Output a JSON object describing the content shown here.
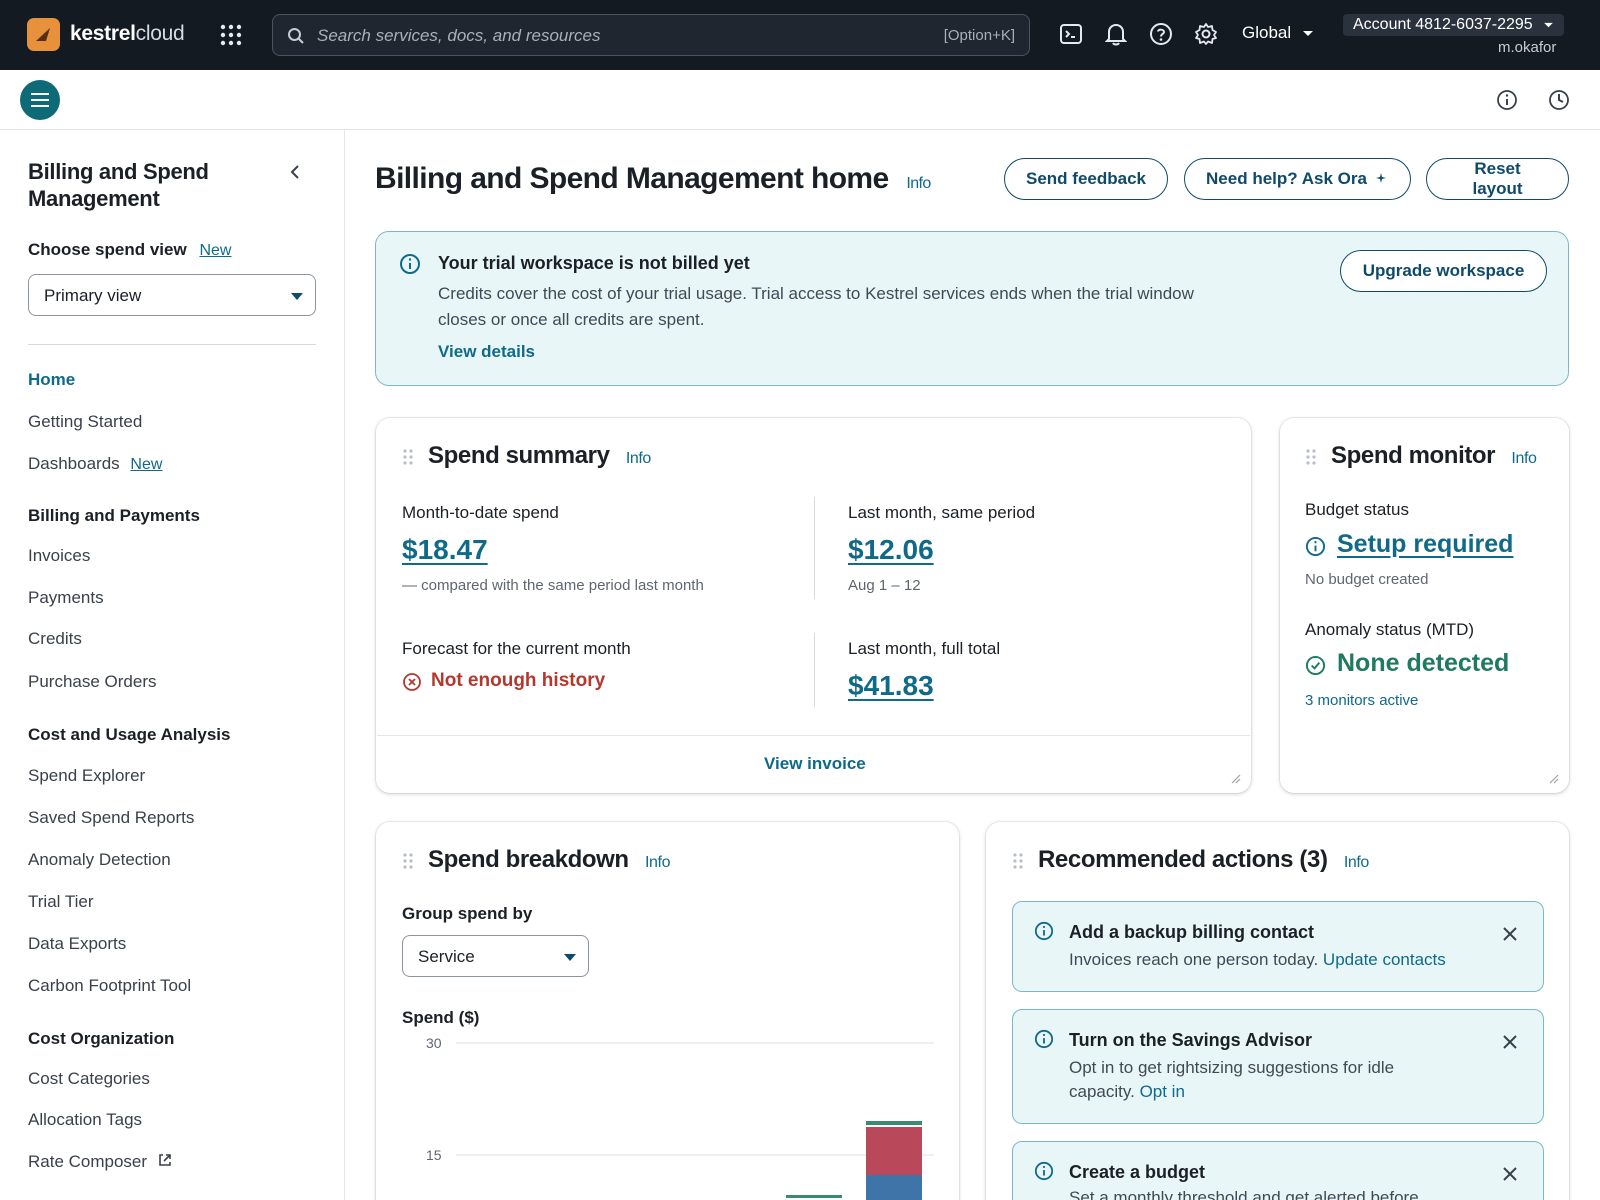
{
  "topbar": {
    "brand_bold": "kestrel",
    "brand_light": "cloud",
    "search_placeholder": "Search services, docs, and resources",
    "search_shortcut": "[Option+K]",
    "region": "Global",
    "account": "Account 4812-6037-2295",
    "user": "m.okafor"
  },
  "sidebar": {
    "title": "Billing and Spend Management",
    "choose_label": "Choose spend view",
    "choose_badge": "New",
    "view_value": "Primary view",
    "items": {
      "home": "Home",
      "getting_started": "Getting Started",
      "dashboards": "Dashboards",
      "dashboards_badge": "New"
    },
    "billing_head": "Billing and Payments",
    "billing": [
      "Invoices",
      "Payments",
      "Credits",
      "Purchase Orders"
    ],
    "cost_head": "Cost and Usage Analysis",
    "cost": [
      "Spend Explorer",
      "Saved Spend Reports",
      "Anomaly Detection",
      "Trial Tier",
      "Data Exports",
      "Carbon Footprint Tool"
    ],
    "org_head": "Cost Organization",
    "org": [
      "Cost Categories",
      "Allocation Tags",
      "Rate Composer"
    ]
  },
  "main": {
    "title": "Billing and Spend Management home",
    "info": "Info",
    "buttons": {
      "feedback": "Send feedback",
      "help": "Need help? Ask Ora",
      "reset": "Reset layout"
    },
    "alert": {
      "title": "Your trial workspace is not billed yet",
      "body": "Credits cover the cost of your trial usage. Trial access to Kestrel services ends when the trial window closes or once all credits are spent.",
      "link": "View details",
      "button": "Upgrade workspace"
    },
    "summary": {
      "title": "Spend summary",
      "mtd_label": "Month-to-date spend",
      "mtd_value": "$18.47",
      "mtd_note": "— compared with the same period last month",
      "last_period_label": "Last month, same period",
      "last_period_value": "$12.06",
      "last_period_range": "Aug 1 – 12",
      "forecast_label": "Forecast for the current month",
      "forecast_value": "Not enough history",
      "last_total_label": "Last month, full total",
      "last_total_value": "$41.83",
      "footer_link": "View invoice"
    },
    "monitor": {
      "title": "Spend monitor",
      "budget_label": "Budget status",
      "budget_value": "Setup required",
      "budget_note": "No budget created",
      "anomaly_label": "Anomaly status (MTD)",
      "anomaly_value": "None detected",
      "anomaly_note": "3 monitors active"
    },
    "breakdown": {
      "title": "Spend breakdown",
      "group_label": "Group spend by",
      "group_value": "Service",
      "axis_title": "Spend ($)"
    },
    "recommended": {
      "title": "Recommended actions (3)",
      "items": [
        {
          "title": "Add a backup billing contact",
          "body": "Invoices reach one person today.",
          "link": "Update contacts"
        },
        {
          "title": "Turn on the Savings Advisor",
          "body": "Opt in to get rightsizing suggestions for idle capacity.",
          "link": "Opt in"
        },
        {
          "title": "Create a budget",
          "body": "Set a monthly threshold and get alerted before",
          "link": ""
        }
      ]
    }
  },
  "chart_data": {
    "type": "bar",
    "ylabel": "Spend ($)",
    "yticks": [
      30,
      15
    ],
    "ylim": [
      0,
      30
    ],
    "colors": {
      "teal": "#3a8a72",
      "red": "#b9485a",
      "blue": "#3f74a8"
    }
  }
}
